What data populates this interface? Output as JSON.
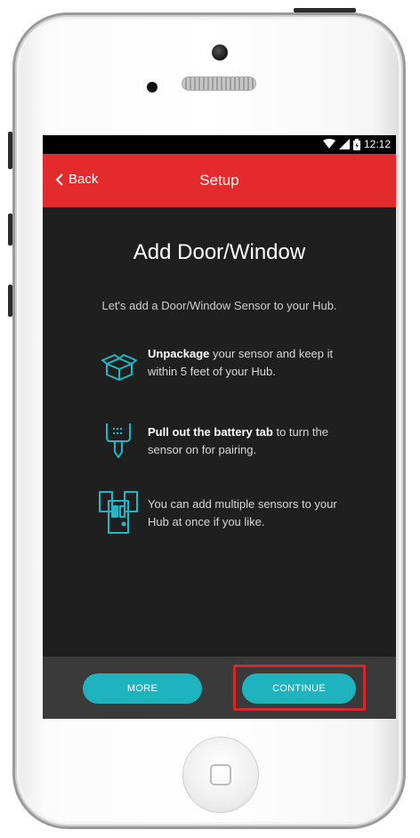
{
  "status_bar": {
    "time": "12:12"
  },
  "app_bar": {
    "back_label": "Back",
    "title": "Setup"
  },
  "main": {
    "heading": "Add Door/Window",
    "subtitle": "Let's add a Door/Window Sensor to your Hub.",
    "steps": [
      {
        "icon": "package-icon",
        "bold": "Unpackage",
        "text": " your sensor and keep it within 5 feet of your Hub."
      },
      {
        "icon": "battery-tab-icon",
        "bold": "Pull out the battery tab",
        "text": " to turn the sensor on for pairing."
      },
      {
        "icon": "multiple-sensors-icon",
        "bold": "",
        "text": "You can add multiple sensors to your Hub at once if you like."
      }
    ]
  },
  "footer": {
    "more_label": "MORE",
    "continue_label": "CONTINUE"
  },
  "colors": {
    "accent": "#e32a2d",
    "button": "#1fb3bf",
    "icon": "#20b8c6",
    "highlight": "#d9262b"
  }
}
